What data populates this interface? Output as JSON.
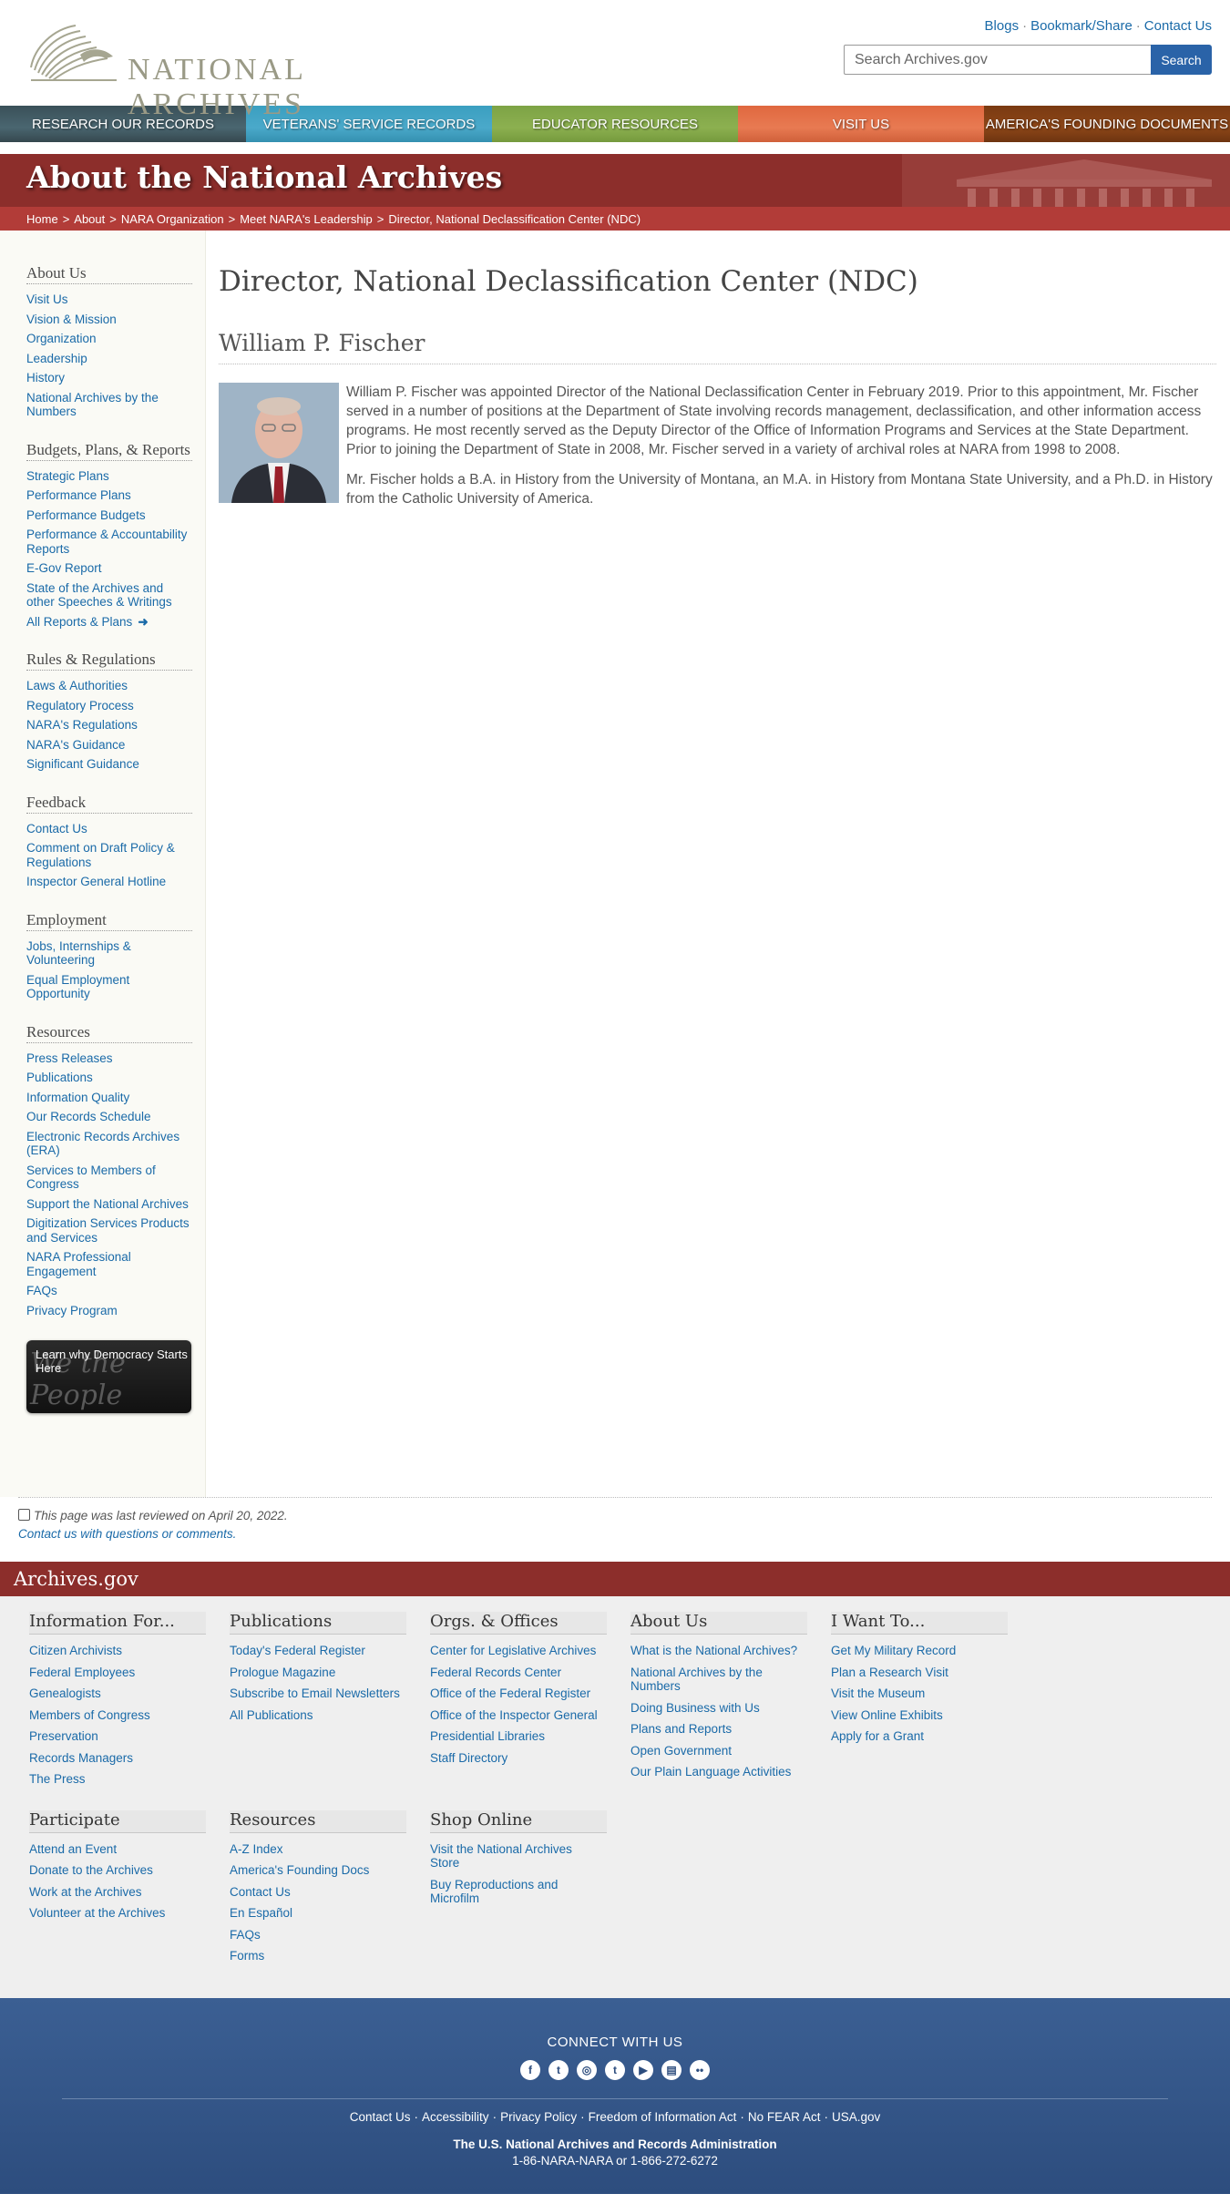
{
  "header": {
    "logo_text": "NATIONAL ARCHIVES",
    "top_links": [
      "Blogs",
      "Bookmark/Share",
      "Contact Us"
    ],
    "search_placeholder": "Search Archives.gov",
    "search_button": "Search"
  },
  "nav": [
    "Research Our Records",
    "Veterans' Service Records",
    "Educator Resources",
    "Visit Us",
    "America's Founding Documents"
  ],
  "banner": {
    "title": "About the National Archives",
    "breadcrumb": [
      "Home",
      "About",
      "NARA Organization",
      "Meet NARA's Leadership",
      "Director, National Declassification Center (NDC)"
    ]
  },
  "sidebar": {
    "groups": [
      {
        "title": "About Us",
        "links": [
          "Visit Us",
          "Vision & Mission",
          "Organization",
          "Leadership",
          "History",
          "National Archives by the Numbers"
        ]
      },
      {
        "title": "Budgets, Plans, & Reports",
        "links": [
          "Strategic Plans",
          "Performance Plans",
          "Performance Budgets",
          "Performance & Accountability Reports",
          "E-Gov Report",
          "State of the Archives and other Speeches & Writings",
          "All Reports & Plans"
        ]
      },
      {
        "title": "Rules & Regulations",
        "links": [
          "Laws & Authorities",
          "Regulatory Process",
          "NARA's Regulations",
          "NARA's Guidance",
          "Significant Guidance"
        ]
      },
      {
        "title": "Feedback",
        "links": [
          "Contact Us",
          "Comment on Draft Policy & Regulations",
          "Inspector General Hotline"
        ]
      },
      {
        "title": "Employment",
        "links": [
          "Jobs, Internships & Volunteering",
          "Equal Employment Opportunity"
        ]
      },
      {
        "title": "Resources",
        "links": [
          "Press Releases",
          "Publications",
          "Information Quality",
          "Our Records Schedule",
          "Electronic Records Archives (ERA)",
          "Services to Members of Congress",
          "Support the National Archives",
          "Digitization Services Products and Services",
          "NARA Professional Engagement",
          "FAQs",
          "Privacy Program"
        ]
      }
    ],
    "promo_text": "Learn why Democracy Starts Here",
    "promo_script": "We the People"
  },
  "content": {
    "title": "Director, National Declassification Center (NDC)",
    "name": "William P. Fischer",
    "paragraphs": [
      "William P. Fischer was appointed Director of the National Declassification Center in February 2019. Prior to this appointment, Mr. Fischer served in a number of positions at the Department of State involving records management, declassification, and other information access programs. He most recently served as the Deputy Director of the Office of Information Programs and Services at the State Department. Prior to joining the Department of State in 2008, Mr. Fischer served in a variety of archival roles at NARA from 1998 to 2008.",
      "Mr. Fischer holds a B.A. in History from the University of Montana, an M.A. in History from Montana State University, and a Ph.D. in History from the Catholic University of America."
    ]
  },
  "review": {
    "reviewed": "This page was last reviewed on April 20, 2022.",
    "contact": "Contact us with questions or comments."
  },
  "footer": {
    "band_title": "Archives.gov",
    "columns": [
      {
        "title": "Information For...",
        "links": [
          "Citizen Archivists",
          "Federal Employees",
          "Genealogists",
          "Members of Congress",
          "Preservation",
          "Records Managers",
          "The Press"
        ]
      },
      {
        "title": "Publications",
        "links": [
          "Today's Federal Register",
          "Prologue Magazine",
          "Subscribe to Email Newsletters",
          "All Publications"
        ]
      },
      {
        "title": "Orgs. & Offices",
        "links": [
          "Center for Legislative Archives",
          "Federal Records Center",
          "Office of the Federal Register",
          "Office of the Inspector General",
          "Presidential Libraries",
          "Staff Directory"
        ]
      },
      {
        "title": "About Us",
        "links": [
          "What is the National Archives?",
          "National Archives by the Numbers",
          "Doing Business with Us",
          "Plans and Reports",
          "Open Government",
          "Our Plain Language Activities"
        ]
      },
      {
        "title": "I Want To...",
        "links": [
          "Get My Military Record",
          "Plan a Research Visit",
          "Visit the Museum",
          "View Online Exhibits",
          "Apply for a Grant"
        ]
      },
      {
        "title": "Participate",
        "links": [
          "Attend an Event",
          "Donate to the Archives",
          "Work at the Archives",
          "Volunteer at the Archives"
        ]
      },
      {
        "title": "Resources",
        "links": [
          "A-Z Index",
          "America's Founding Docs",
          "Contact Us",
          "En Español",
          "FAQs",
          "Forms"
        ]
      },
      {
        "title": "Shop Online",
        "links": [
          "Visit the National Archives Store",
          "Buy Reproductions and Microfilm"
        ]
      }
    ],
    "connect": "CONNECT WITH US",
    "socials": [
      {
        "icon": "facebook-icon",
        "glyph": "f"
      },
      {
        "icon": "twitter-icon",
        "glyph": "t"
      },
      {
        "icon": "instagram-icon",
        "glyph": "◎"
      },
      {
        "icon": "tumblr-icon",
        "glyph": "t"
      },
      {
        "icon": "youtube-icon",
        "glyph": "▶"
      },
      {
        "icon": "blogs-icon",
        "glyph": "▤"
      },
      {
        "icon": "flickr-icon",
        "glyph": "••"
      }
    ],
    "legal": [
      "Contact Us",
      "Accessibility",
      "Privacy Policy",
      "Freedom of Information Act",
      "No FEAR Act",
      "USA.gov"
    ],
    "agency": "The U.S. National Archives and Records Administration",
    "phone": "1-86-NARA-NARA or 1-866-272-6272"
  }
}
